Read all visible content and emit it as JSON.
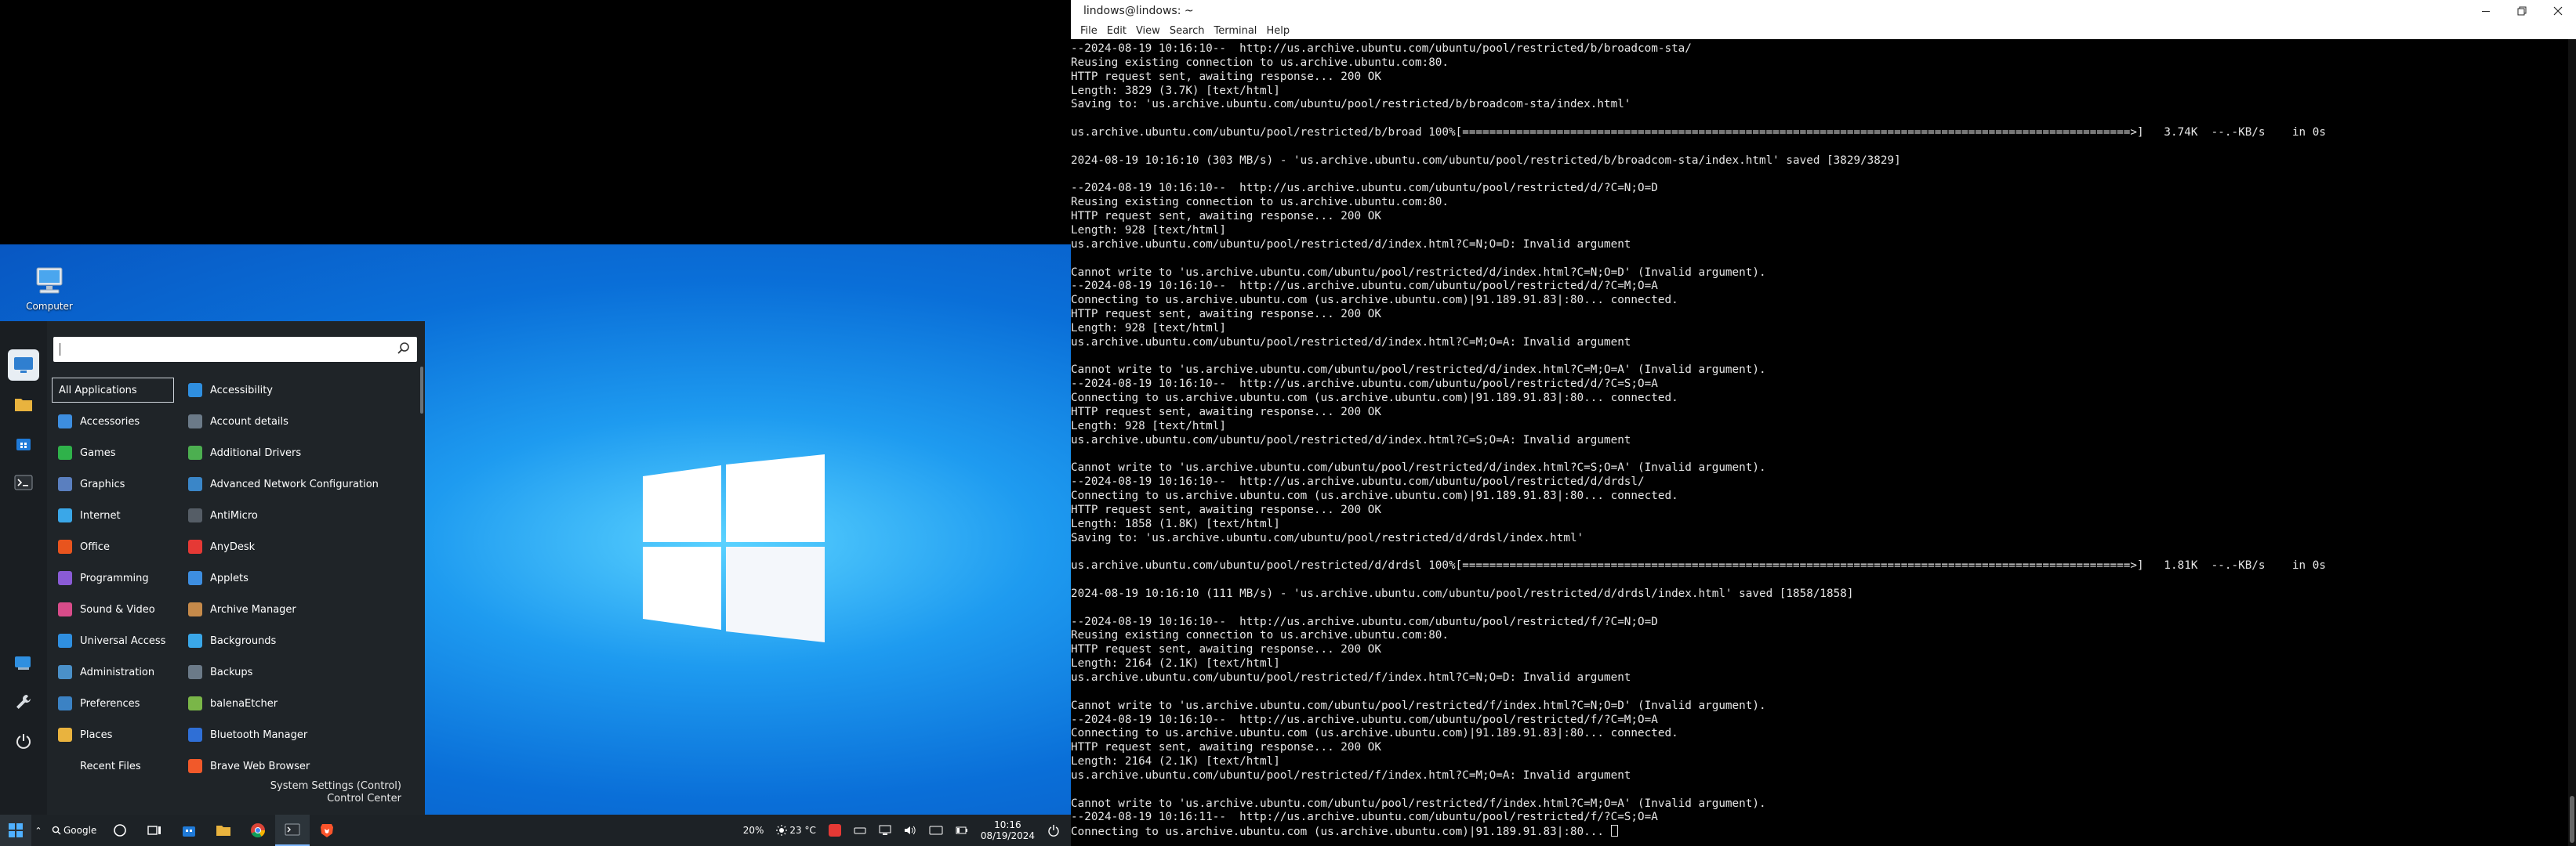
{
  "desktop": {
    "icon_computer_label": "Computer"
  },
  "start_menu": {
    "categories": [
      {
        "label": "All Applications",
        "color": "#2d3338"
      },
      {
        "label": "Accessories",
        "color": "#3d8ee0"
      },
      {
        "label": "Games",
        "color": "#2fb24a"
      },
      {
        "label": "Graphics",
        "color": "#5a7fbf"
      },
      {
        "label": "Internet",
        "color": "#3aa7e8"
      },
      {
        "label": "Office",
        "color": "#e8541e"
      },
      {
        "label": "Programming",
        "color": "#8a5bd6"
      },
      {
        "label": "Sound & Video",
        "color": "#d84c8a"
      },
      {
        "label": "Universal Access",
        "color": "#2f8fe0"
      },
      {
        "label": "Administration",
        "color": "#4a90c8"
      },
      {
        "label": "Preferences",
        "color": "#3b82c4"
      },
      {
        "label": "Places",
        "color": "#e9b33e"
      },
      {
        "label": "Recent Files",
        "color": "#1f2428"
      }
    ],
    "apps": [
      {
        "label": "Accessibility",
        "color": "#2f8fe0"
      },
      {
        "label": "Account details",
        "color": "#6b7a88"
      },
      {
        "label": "Additional Drivers",
        "color": "#4caf50"
      },
      {
        "label": "Advanced Network Configuration",
        "color": "#3a86c8"
      },
      {
        "label": "AntiMicro",
        "color": "#555d66"
      },
      {
        "label": "AnyDesk",
        "color": "#e53935"
      },
      {
        "label": "Applets",
        "color": "#3d8ee0"
      },
      {
        "label": "Archive Manager",
        "color": "#c58a4a"
      },
      {
        "label": "Backgrounds",
        "color": "#3aa7e8"
      },
      {
        "label": "Backups",
        "color": "#6b7a88"
      },
      {
        "label": "balenaEtcher",
        "color": "#7ab648"
      },
      {
        "label": "Bluetooth Manager",
        "color": "#2f6fd6"
      },
      {
        "label": "Brave Web Browser",
        "color": "#f1592a"
      }
    ],
    "footer_line1": "System Settings (Control)",
    "footer_line2": "Control Center"
  },
  "taskbar": {
    "search_label": "Google",
    "battery": "20%",
    "weather": "23 °C",
    "time": "10:16",
    "date": "08/19/2024"
  },
  "terminal": {
    "title": "lindows@lindows: ~",
    "menus": [
      "File",
      "Edit",
      "View",
      "Search",
      "Terminal",
      "Help"
    ],
    "lines": [
      "--2024-08-19 10:16:10--  http://us.archive.ubuntu.com/ubuntu/pool/restricted/b/broadcom-sta/",
      "Reusing existing connection to us.archive.ubuntu.com:80.",
      "HTTP request sent, awaiting response... 200 OK",
      "Length: 3829 (3.7K) [text/html]",
      "Saving to: 'us.archive.ubuntu.com/ubuntu/pool/restricted/b/broadcom-sta/index.html'",
      "",
      "us.archive.ubuntu.com/ubuntu/pool/restricted/b/broad 100%[===================================================================================================>]   3.74K  --.-KB/s    in 0s",
      "",
      "2024-08-19 10:16:10 (303 MB/s) - 'us.archive.ubuntu.com/ubuntu/pool/restricted/b/broadcom-sta/index.html' saved [3829/3829]",
      "",
      "--2024-08-19 10:16:10--  http://us.archive.ubuntu.com/ubuntu/pool/restricted/d/?C=N;O=D",
      "Reusing existing connection to us.archive.ubuntu.com:80.",
      "HTTP request sent, awaiting response... 200 OK",
      "Length: 928 [text/html]",
      "us.archive.ubuntu.com/ubuntu/pool/restricted/d/index.html?C=N;O=D: Invalid argument",
      "",
      "Cannot write to 'us.archive.ubuntu.com/ubuntu/pool/restricted/d/index.html?C=N;O=D' (Invalid argument).",
      "--2024-08-19 10:16:10--  http://us.archive.ubuntu.com/ubuntu/pool/restricted/d/?C=M;O=A",
      "Connecting to us.archive.ubuntu.com (us.archive.ubuntu.com)|91.189.91.83|:80... connected.",
      "HTTP request sent, awaiting response... 200 OK",
      "Length: 928 [text/html]",
      "us.archive.ubuntu.com/ubuntu/pool/restricted/d/index.html?C=M;O=A: Invalid argument",
      "",
      "Cannot write to 'us.archive.ubuntu.com/ubuntu/pool/restricted/d/index.html?C=M;O=A' (Invalid argument).",
      "--2024-08-19 10:16:10--  http://us.archive.ubuntu.com/ubuntu/pool/restricted/d/?C=S;O=A",
      "Connecting to us.archive.ubuntu.com (us.archive.ubuntu.com)|91.189.91.83|:80... connected.",
      "HTTP request sent, awaiting response... 200 OK",
      "Length: 928 [text/html]",
      "us.archive.ubuntu.com/ubuntu/pool/restricted/d/index.html?C=S;O=A: Invalid argument",
      "",
      "Cannot write to 'us.archive.ubuntu.com/ubuntu/pool/restricted/d/index.html?C=S;O=A' (Invalid argument).",
      "--2024-08-19 10:16:10--  http://us.archive.ubuntu.com/ubuntu/pool/restricted/d/drdsl/",
      "Connecting to us.archive.ubuntu.com (us.archive.ubuntu.com)|91.189.91.83|:80... connected.",
      "HTTP request sent, awaiting response... 200 OK",
      "Length: 1858 (1.8K) [text/html]",
      "Saving to: 'us.archive.ubuntu.com/ubuntu/pool/restricted/d/drdsl/index.html'",
      "",
      "us.archive.ubuntu.com/ubuntu/pool/restricted/d/drdsl 100%[===================================================================================================>]   1.81K  --.-KB/s    in 0s",
      "",
      "2024-08-19 10:16:10 (111 MB/s) - 'us.archive.ubuntu.com/ubuntu/pool/restricted/d/drdsl/index.html' saved [1858/1858]",
      "",
      "--2024-08-19 10:16:10--  http://us.archive.ubuntu.com/ubuntu/pool/restricted/f/?C=N;O=D",
      "Reusing existing connection to us.archive.ubuntu.com:80.",
      "HTTP request sent, awaiting response... 200 OK",
      "Length: 2164 (2.1K) [text/html]",
      "us.archive.ubuntu.com/ubuntu/pool/restricted/f/index.html?C=N;O=D: Invalid argument",
      "",
      "Cannot write to 'us.archive.ubuntu.com/ubuntu/pool/restricted/f/index.html?C=N;O=D' (Invalid argument).",
      "--2024-08-19 10:16:10--  http://us.archive.ubuntu.com/ubuntu/pool/restricted/f/?C=M;O=A",
      "Connecting to us.archive.ubuntu.com (us.archive.ubuntu.com)|91.189.91.83|:80... connected.",
      "HTTP request sent, awaiting response... 200 OK",
      "Length: 2164 (2.1K) [text/html]",
      "us.archive.ubuntu.com/ubuntu/pool/restricted/f/index.html?C=M;O=A: Invalid argument",
      "",
      "Cannot write to 'us.archive.ubuntu.com/ubuntu/pool/restricted/f/index.html?C=M;O=A' (Invalid argument).",
      "--2024-08-19 10:16:11--  http://us.archive.ubuntu.com/ubuntu/pool/restricted/f/?C=S;O=A",
      "Connecting to us.archive.ubuntu.com (us.archive.ubuntu.com)|91.189.91.83|:80... "
    ]
  },
  "colors": {
    "terminal_bg": "#000000",
    "terminal_fg": "#e6e6e6",
    "menu_bg": "#1f2428",
    "taskbar_bg": "#1d2226"
  }
}
